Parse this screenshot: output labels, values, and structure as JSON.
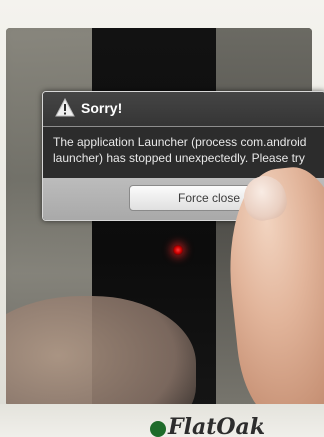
{
  "dialog": {
    "title": "Sorry!",
    "message_line1": "The application Launcher (process com.android",
    "message_line2": "launcher) has stopped unexpectedly. Please try",
    "button_label": "Force close",
    "icon": "warning-icon"
  },
  "device": {
    "brand": "FlatOak",
    "brand_logo": "flatoak-logo",
    "led_color": "#ff2a2a"
  }
}
